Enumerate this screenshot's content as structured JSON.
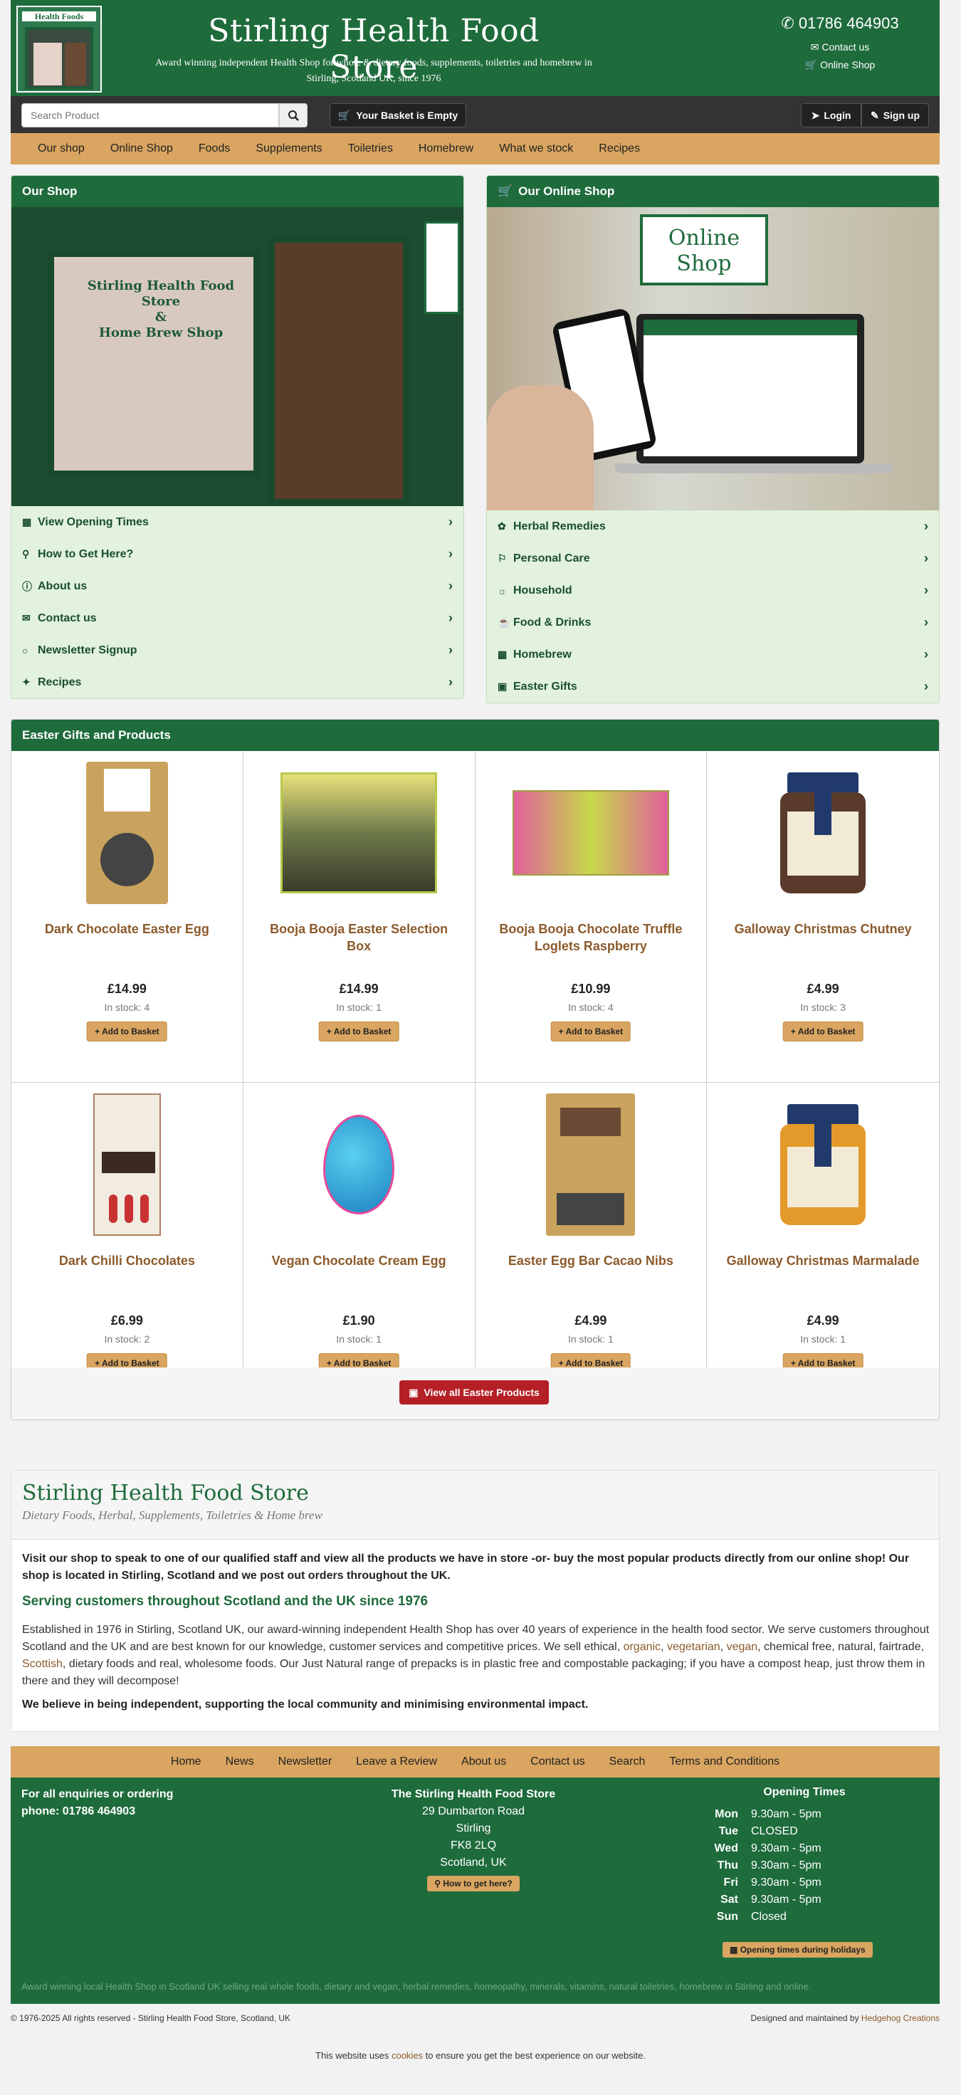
{
  "header": {
    "logo_text": "Health Foods",
    "title": "Stirling Health Food Store",
    "subtitle_line1": "Award winning independent Health Shop for whole & dietary foods, supplements, toiletries and homebrew in",
    "subtitle_line2": "Stirling, Scotland UK, since 1976",
    "phone": "01786 464903",
    "contact_label": "Contact us",
    "online_label": "Online Shop"
  },
  "topbar": {
    "search_placeholder": "Search Product",
    "basket_label": "Your Basket is Empty",
    "login_label": "Login",
    "signup_label": "Sign up"
  },
  "nav": [
    "Our shop",
    "Online Shop",
    "Foods",
    "Supplements",
    "Toiletries",
    "Homebrew",
    "What we stock",
    "Recipes"
  ],
  "our_shop": {
    "title": "Our Shop",
    "sign_line1": "Stirling Health Food Store",
    "sign_line2": "&",
    "sign_line3": "Home Brew Shop",
    "items": [
      "View Opening Times",
      "How to Get Here?",
      "About us",
      "Contact us",
      "Newsletter Signup",
      "Recipes"
    ]
  },
  "online_shop": {
    "title": "Our Online Shop",
    "sign_line1": "Online",
    "sign_line2": "Shop",
    "items": [
      "Herbal Remedies",
      "Personal Care",
      "Household",
      "Food & Drinks",
      "Homebrew",
      "Easter Gifts"
    ]
  },
  "easter": {
    "title": "Easter Gifts and Products",
    "add_label": "Add to Basket",
    "view_all_label": "View all Easter Products",
    "products": [
      {
        "name": "Dark Chocolate Easter Egg",
        "price": "£14.99",
        "stock": "In stock: 4"
      },
      {
        "name": "Booja Booja Easter Selection Box",
        "price": "£14.99",
        "stock": "In stock: 1"
      },
      {
        "name": "Booja Booja Chocolate Truffle Loglets Raspberry",
        "price": "£10.99",
        "stock": "In stock: 4"
      },
      {
        "name": "Galloway Christmas Chutney",
        "price": "£4.99",
        "stock": "In stock: 3"
      },
      {
        "name": "Dark Chilli Chocolates",
        "price": "£6.99",
        "stock": "In stock: 2"
      },
      {
        "name": "Vegan Chocolate Cream Egg",
        "price": "£1.90",
        "stock": "In stock: 1"
      },
      {
        "name": "Easter Egg Bar Cacao Nibs",
        "price": "£4.99",
        "stock": "In stock: 1"
      },
      {
        "name": "Galloway Christmas Marmalade",
        "price": "£4.99",
        "stock": "In stock: 1"
      }
    ]
  },
  "about": {
    "title": "Stirling Health Food Store",
    "subtitle": "Dietary Foods, Herbal, Supplements, Toiletries & Home brew",
    "intro": "Visit our shop to speak to one of our qualified staff and view all the products we have in store -or- buy the most popular products directly from our online shop! Our shop is located in Stirling, Scotland and we post out orders throughout the UK.",
    "heading": "Serving customers throughout Scotland and the UK since 1976",
    "body_a": "Established in 1976 in Stirling, Scotland UK, our award-winning independent Health Shop has over 40 years of experience in the health food sector. We serve customers throughout Scotland and the UK and are best known for our knowledge, customer services and competitive prices. We sell ethical, ",
    "link_organic": "organic",
    "link_vegetarian": "vegetarian",
    "link_vegan": "vegan",
    "body_b": ", chemical free, natural, fairtrade, ",
    "link_scottish": "Scottish",
    "body_c": ", dietary foods and real, wholesome foods. Our Just Natural range of prepacks is in plastic free and compostable packaging; if you have a compost heap, just throw them in there and they will decompose!",
    "belief": "We believe in being independent, supporting the local community and minimising environmental impact."
  },
  "footer_nav": [
    "Home",
    "News",
    "Newsletter",
    "Leave a Review",
    "About us",
    "Contact us",
    "Search",
    "Terms and Conditions"
  ],
  "footer": {
    "enquiries_line1": "For all enquiries or ordering",
    "enquiries_line2": "phone: 01786 464903",
    "address_title": "The Stirling Health Food Store",
    "address": [
      "29 Dumbarton Road",
      "Stirling",
      "FK8 2LQ",
      "Scotland, UK"
    ],
    "directions_label": "How to get here?",
    "hours_title": "Opening Times",
    "hours": [
      {
        "day": "Mon",
        "time": "9.30am - 5pm"
      },
      {
        "day": "Tue",
        "time": "CLOSED"
      },
      {
        "day": "Wed",
        "time": "9.30am - 5pm"
      },
      {
        "day": "Thu",
        "time": "9.30am - 5pm"
      },
      {
        "day": "Fri",
        "time": "9.30am - 5pm"
      },
      {
        "day": "Sat",
        "time": "9.30am - 5pm"
      },
      {
        "day": "Sun",
        "time": "Closed"
      }
    ],
    "holidays_label": "Opening times during holidays",
    "seo_text": "Award winning local Health Shop in Scotland UK selling real whole foods, dietary and vegan, herbal remedies, homeopathy, minerals, vitamins, natural toiletries, homebrew in Stirling and online."
  },
  "copyright": "© 1976-2025 All rights reserved - Stirling Health Food Store, Scotland, UK",
  "designed_prefix": "Designed and maintained by ",
  "designed_by": "Hedgehog Creations",
  "cookies_a": "This website uses ",
  "cookies_link": "cookies",
  "cookies_b": " to ensure you get the best experience on our website.",
  "colors": {
    "brand_green": "#1e6b3c",
    "tan": "#d9a560",
    "panel_bg": "#e2f2dd",
    "link_brown": "#8b5a2b",
    "red": "#b52026"
  },
  "icons": {
    "phone": "phone-icon",
    "envelope": "envelope-icon",
    "cart": "cart-icon",
    "search": "search-icon",
    "basket": "basket-icon",
    "login": "login-icon",
    "signup": "edit-icon",
    "chevron": "chevron-right-icon",
    "gift": "gift-icon"
  }
}
